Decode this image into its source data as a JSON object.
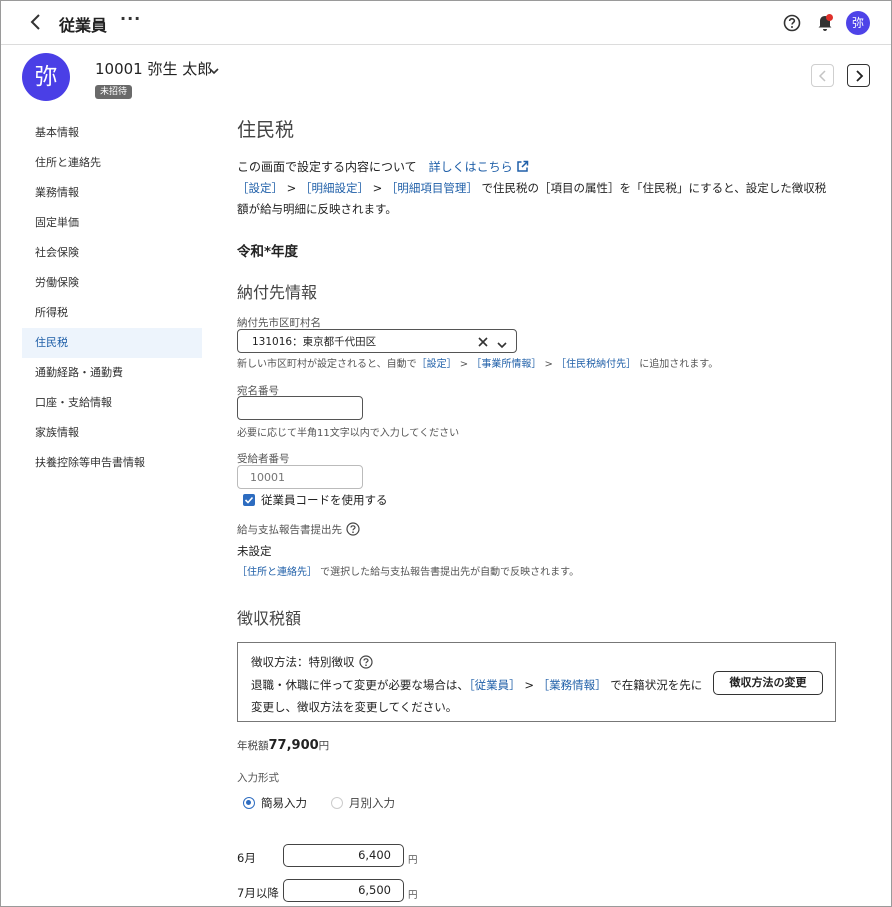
{
  "header": {
    "title": "従業員",
    "more": "···",
    "avatar": "弥"
  },
  "employee": {
    "avatar": "弥",
    "name": "10001 弥生 太郎",
    "badge": "未招待"
  },
  "sidebar": {
    "items": [
      {
        "label": "基本情報"
      },
      {
        "label": "住所と連絡先"
      },
      {
        "label": "業務情報"
      },
      {
        "label": "固定単価"
      },
      {
        "label": "社会保険"
      },
      {
        "label": "労働保険"
      },
      {
        "label": "所得税"
      },
      {
        "label": "住民税",
        "active": true
      },
      {
        "label": "通勤経路・通勤費"
      },
      {
        "label": "口座・支給情報"
      },
      {
        "label": "家族情報"
      },
      {
        "label": "扶養控除等申告書情報"
      }
    ]
  },
  "main": {
    "title": "住民税",
    "about_text": "この画面で設定する内容について",
    "about_link": "詳しくはこちら",
    "desc": {
      "link1": "［設定］",
      "sep1": " > ",
      "link2": "［明細設定］",
      "sep2": " > ",
      "link3": "［明細項目管理］",
      "rest": " で住民税の［項目の属性］を「住民税」にすると、設定した徴収税額が給与明細に反映されます。"
    },
    "year": "令和*年度",
    "payee_section": "納付先情報",
    "municipality": {
      "label": "納付先市区町村名",
      "value": "131016：東京都千代田区",
      "hint_pre": "新しい市区町村が設定されると、自動で",
      "hint_link1": "［設定］",
      "hint_sep1": " > ",
      "hint_link2": "［事業所情報］",
      "hint_sep2": " > ",
      "hint_link3": "［住民税納付先］",
      "hint_post": " に追加されます。"
    },
    "addressee": {
      "label": "宛名番号",
      "value": "",
      "hint": "必要に応じて半角11文字以内で入力してください"
    },
    "recipient": {
      "label": "受給者番号",
      "placeholder": "10001",
      "checkbox_label": "従業員コードを使用する"
    },
    "report": {
      "label": "給与支払報告書提出先",
      "value": "未設定",
      "hint_link": "［住所と連絡先］",
      "hint_post": " で選択した給与支払報告書提出先が自動で反映されます。"
    },
    "collect_section": "徴収税額",
    "collect_box": {
      "method": "徴収方法：特別徴収",
      "text_pre": "退職・休職に伴って変更が必要な場合は、",
      "link1": "［従業員］",
      "sep": " > ",
      "link2": "［業務情報］",
      "text_post": " で在籍状況を先に変更し、徴収方法を変更してください。",
      "button": "徴収方法の変更"
    },
    "annual": {
      "label": "年税額",
      "amount": "77,900",
      "yen": "円"
    },
    "input_type": {
      "label": "入力形式",
      "option1": "簡易入力",
      "option2": "月別入力",
      "selected": "簡易入力"
    },
    "months": [
      {
        "label": "6月",
        "value": "6,400",
        "yen": "円"
      },
      {
        "label": "7月以降",
        "value": "6,500",
        "yen": "円"
      }
    ]
  }
}
